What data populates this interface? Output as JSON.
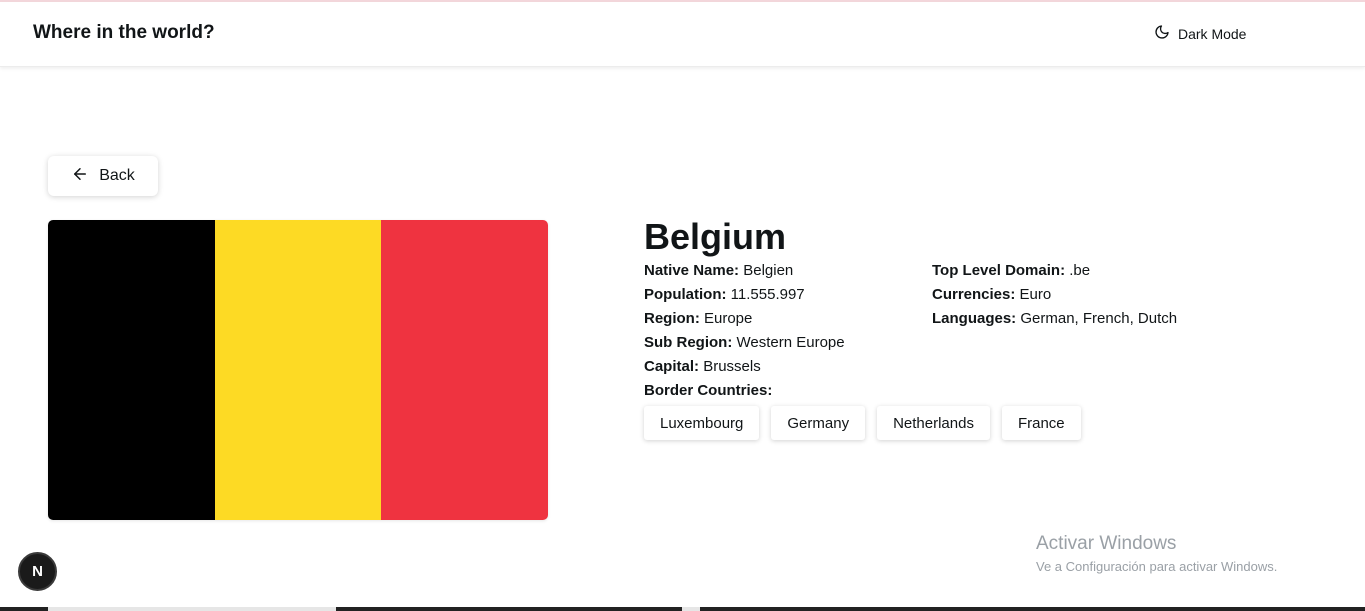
{
  "header": {
    "title": "Where in the world?",
    "dark_mode_label": "Dark Mode"
  },
  "back_label": "Back",
  "flag": {
    "colors": [
      "#000000",
      "#fdda24",
      "#ef3340"
    ]
  },
  "country": {
    "name": "Belgium",
    "left_info": [
      {
        "label": "Native Name:",
        "value": "Belgien"
      },
      {
        "label": "Population:",
        "value": "11.555.997"
      },
      {
        "label": "Region:",
        "value": "Europe"
      },
      {
        "label": "Sub Region:",
        "value": "Western Europe"
      },
      {
        "label": "Capital:",
        "value": "Brussels"
      }
    ],
    "right_info": [
      {
        "label": "Top Level Domain:",
        "value": ".be"
      },
      {
        "label": "Currencies:",
        "value": "Euro"
      },
      {
        "label": "Languages:",
        "value": "German, French, Dutch"
      }
    ],
    "border_label": "Border Countries:",
    "borders": [
      "Luxembourg",
      "Germany",
      "Netherlands",
      "France"
    ]
  },
  "os_watermark": {
    "title": "Activar Windows",
    "subtitle": "Ve a Configuración para activar Windows."
  },
  "dev_badge": "N"
}
